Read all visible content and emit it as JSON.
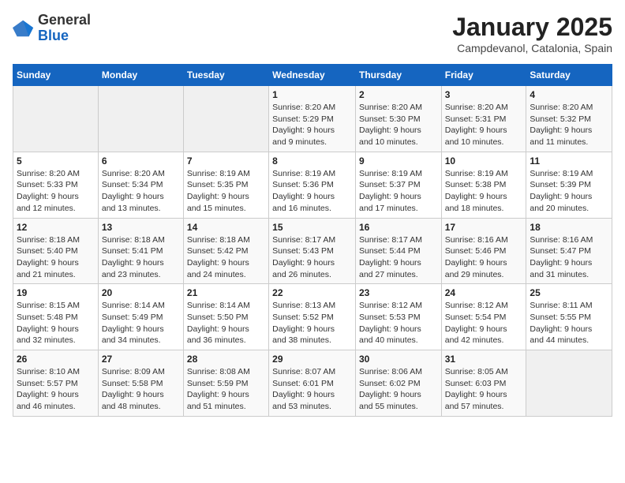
{
  "header": {
    "logo_general": "General",
    "logo_blue": "Blue",
    "month_title": "January 2025",
    "location": "Campdevanol, Catalonia, Spain"
  },
  "days_of_week": [
    "Sunday",
    "Monday",
    "Tuesday",
    "Wednesday",
    "Thursday",
    "Friday",
    "Saturday"
  ],
  "weeks": [
    [
      {
        "day": "",
        "info": ""
      },
      {
        "day": "",
        "info": ""
      },
      {
        "day": "",
        "info": ""
      },
      {
        "day": "1",
        "info": "Sunrise: 8:20 AM\nSunset: 5:29 PM\nDaylight: 9 hours\nand 9 minutes."
      },
      {
        "day": "2",
        "info": "Sunrise: 8:20 AM\nSunset: 5:30 PM\nDaylight: 9 hours\nand 10 minutes."
      },
      {
        "day": "3",
        "info": "Sunrise: 8:20 AM\nSunset: 5:31 PM\nDaylight: 9 hours\nand 10 minutes."
      },
      {
        "day": "4",
        "info": "Sunrise: 8:20 AM\nSunset: 5:32 PM\nDaylight: 9 hours\nand 11 minutes."
      }
    ],
    [
      {
        "day": "5",
        "info": "Sunrise: 8:20 AM\nSunset: 5:33 PM\nDaylight: 9 hours\nand 12 minutes."
      },
      {
        "day": "6",
        "info": "Sunrise: 8:20 AM\nSunset: 5:34 PM\nDaylight: 9 hours\nand 13 minutes."
      },
      {
        "day": "7",
        "info": "Sunrise: 8:19 AM\nSunset: 5:35 PM\nDaylight: 9 hours\nand 15 minutes."
      },
      {
        "day": "8",
        "info": "Sunrise: 8:19 AM\nSunset: 5:36 PM\nDaylight: 9 hours\nand 16 minutes."
      },
      {
        "day": "9",
        "info": "Sunrise: 8:19 AM\nSunset: 5:37 PM\nDaylight: 9 hours\nand 17 minutes."
      },
      {
        "day": "10",
        "info": "Sunrise: 8:19 AM\nSunset: 5:38 PM\nDaylight: 9 hours\nand 18 minutes."
      },
      {
        "day": "11",
        "info": "Sunrise: 8:19 AM\nSunset: 5:39 PM\nDaylight: 9 hours\nand 20 minutes."
      }
    ],
    [
      {
        "day": "12",
        "info": "Sunrise: 8:18 AM\nSunset: 5:40 PM\nDaylight: 9 hours\nand 21 minutes."
      },
      {
        "day": "13",
        "info": "Sunrise: 8:18 AM\nSunset: 5:41 PM\nDaylight: 9 hours\nand 23 minutes."
      },
      {
        "day": "14",
        "info": "Sunrise: 8:18 AM\nSunset: 5:42 PM\nDaylight: 9 hours\nand 24 minutes."
      },
      {
        "day": "15",
        "info": "Sunrise: 8:17 AM\nSunset: 5:43 PM\nDaylight: 9 hours\nand 26 minutes."
      },
      {
        "day": "16",
        "info": "Sunrise: 8:17 AM\nSunset: 5:44 PM\nDaylight: 9 hours\nand 27 minutes."
      },
      {
        "day": "17",
        "info": "Sunrise: 8:16 AM\nSunset: 5:46 PM\nDaylight: 9 hours\nand 29 minutes."
      },
      {
        "day": "18",
        "info": "Sunrise: 8:16 AM\nSunset: 5:47 PM\nDaylight: 9 hours\nand 31 minutes."
      }
    ],
    [
      {
        "day": "19",
        "info": "Sunrise: 8:15 AM\nSunset: 5:48 PM\nDaylight: 9 hours\nand 32 minutes."
      },
      {
        "day": "20",
        "info": "Sunrise: 8:14 AM\nSunset: 5:49 PM\nDaylight: 9 hours\nand 34 minutes."
      },
      {
        "day": "21",
        "info": "Sunrise: 8:14 AM\nSunset: 5:50 PM\nDaylight: 9 hours\nand 36 minutes."
      },
      {
        "day": "22",
        "info": "Sunrise: 8:13 AM\nSunset: 5:52 PM\nDaylight: 9 hours\nand 38 minutes."
      },
      {
        "day": "23",
        "info": "Sunrise: 8:12 AM\nSunset: 5:53 PM\nDaylight: 9 hours\nand 40 minutes."
      },
      {
        "day": "24",
        "info": "Sunrise: 8:12 AM\nSunset: 5:54 PM\nDaylight: 9 hours\nand 42 minutes."
      },
      {
        "day": "25",
        "info": "Sunrise: 8:11 AM\nSunset: 5:55 PM\nDaylight: 9 hours\nand 44 minutes."
      }
    ],
    [
      {
        "day": "26",
        "info": "Sunrise: 8:10 AM\nSunset: 5:57 PM\nDaylight: 9 hours\nand 46 minutes."
      },
      {
        "day": "27",
        "info": "Sunrise: 8:09 AM\nSunset: 5:58 PM\nDaylight: 9 hours\nand 48 minutes."
      },
      {
        "day": "28",
        "info": "Sunrise: 8:08 AM\nSunset: 5:59 PM\nDaylight: 9 hours\nand 51 minutes."
      },
      {
        "day": "29",
        "info": "Sunrise: 8:07 AM\nSunset: 6:01 PM\nDaylight: 9 hours\nand 53 minutes."
      },
      {
        "day": "30",
        "info": "Sunrise: 8:06 AM\nSunset: 6:02 PM\nDaylight: 9 hours\nand 55 minutes."
      },
      {
        "day": "31",
        "info": "Sunrise: 8:05 AM\nSunset: 6:03 PM\nDaylight: 9 hours\nand 57 minutes."
      },
      {
        "day": "",
        "info": ""
      }
    ]
  ]
}
